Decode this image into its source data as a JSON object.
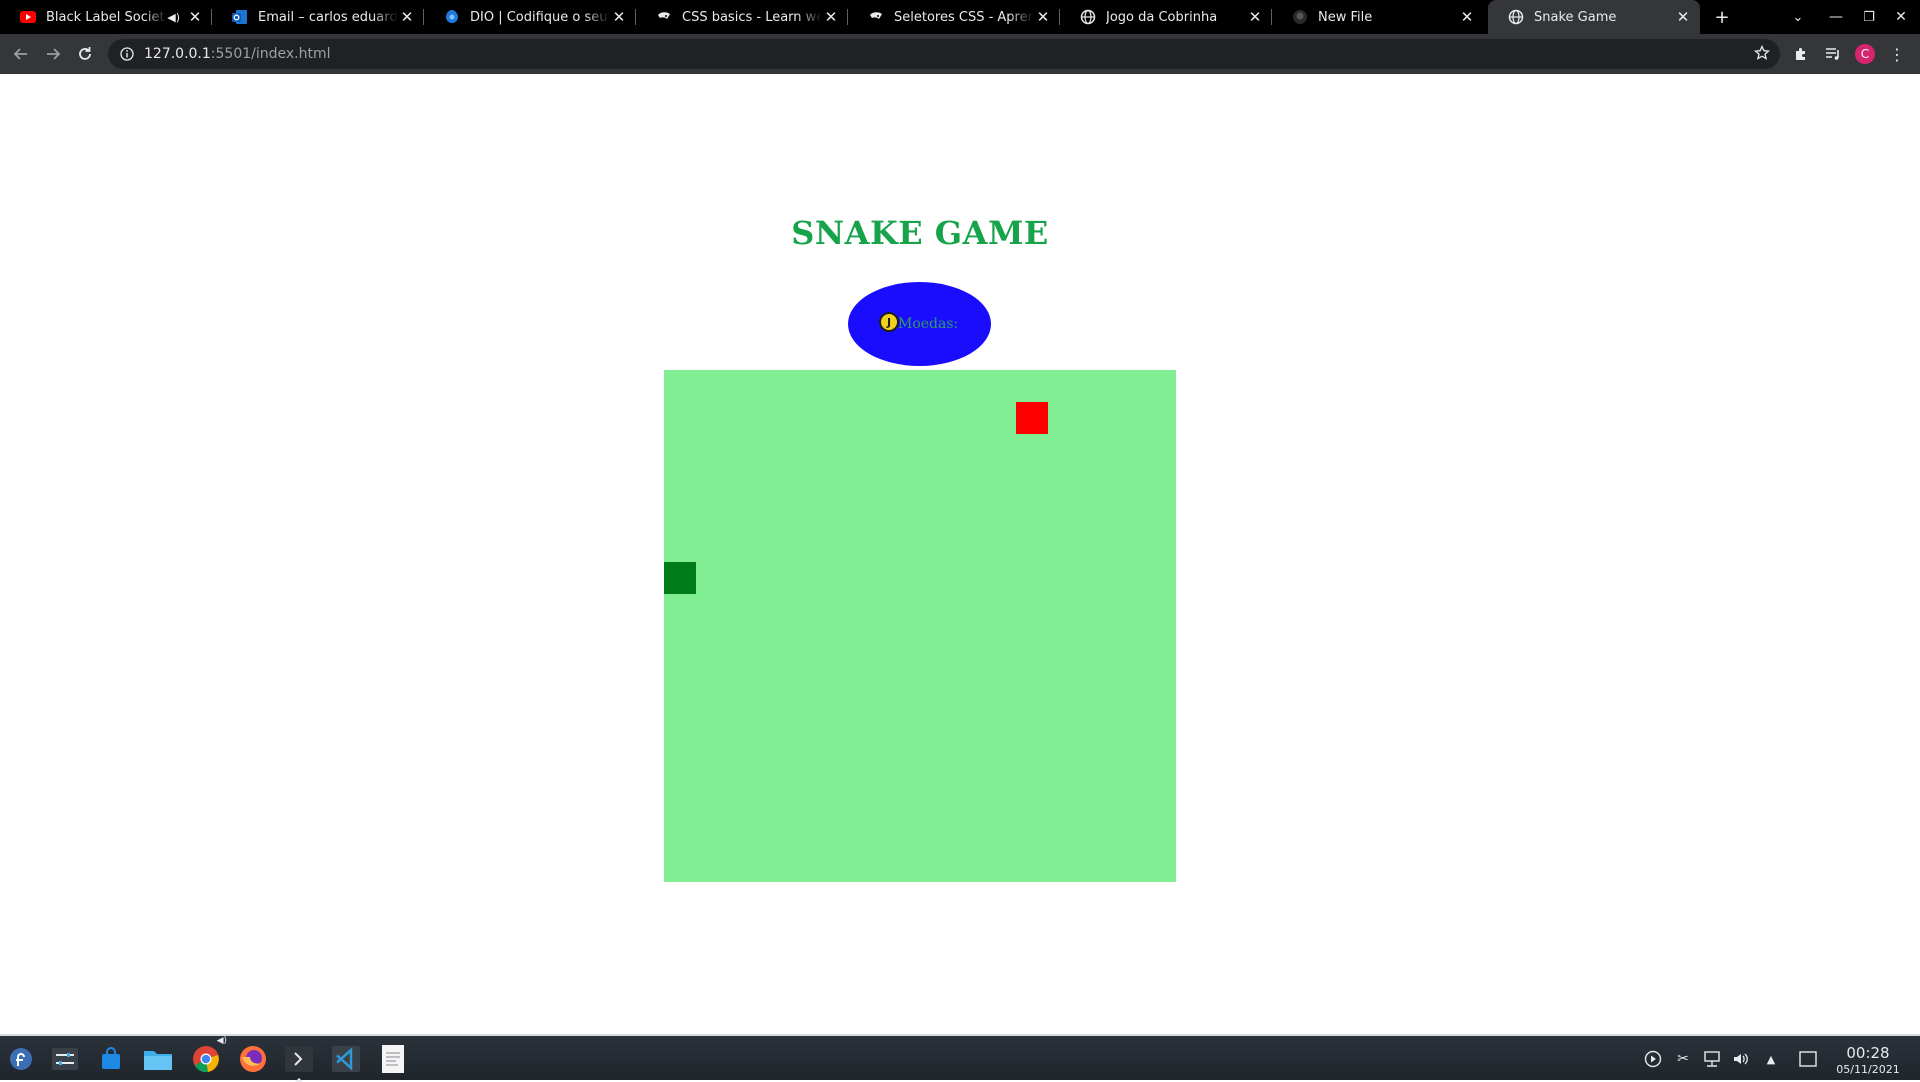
{
  "browser": {
    "tabs": [
      {
        "title": "Black Label Society B",
        "favicon": "youtube-icon",
        "audio": true
      },
      {
        "title": "Email – carlos eduardo –",
        "favicon": "outlook-icon"
      },
      {
        "title": "DIO | Codifique o seu fu",
        "favicon": "dio-icon"
      },
      {
        "title": "CSS basics - Learn web d",
        "favicon": "mdn-icon"
      },
      {
        "title": "Seletores CSS - Aprenda",
        "favicon": "mdn-icon"
      },
      {
        "title": "Jogo da Cobrinha",
        "favicon": "globe-icon"
      },
      {
        "title": "New File",
        "favicon": "github-icon"
      },
      {
        "title": "Snake Game",
        "favicon": "globe-icon",
        "active": true
      }
    ],
    "url_host": "127.0.0.1",
    "url_path": ":5501/index.html",
    "profile_initial": "C"
  },
  "page": {
    "title": "SNAKE GAME",
    "coin_label": "Moedas:",
    "coin_glyph": "J"
  },
  "game": {
    "grid_cells": 16,
    "food": {
      "col": 11,
      "row": 1
    },
    "snake": [
      {
        "col": 0,
        "row": 6
      }
    ]
  },
  "taskbar": {
    "time": "00:28",
    "date": "05/11/2021"
  },
  "colors": {
    "title": "#16a34a",
    "badge": "#1a0cfc",
    "board": "#82ee94",
    "food": "#ff0000",
    "snake": "#007c19"
  }
}
